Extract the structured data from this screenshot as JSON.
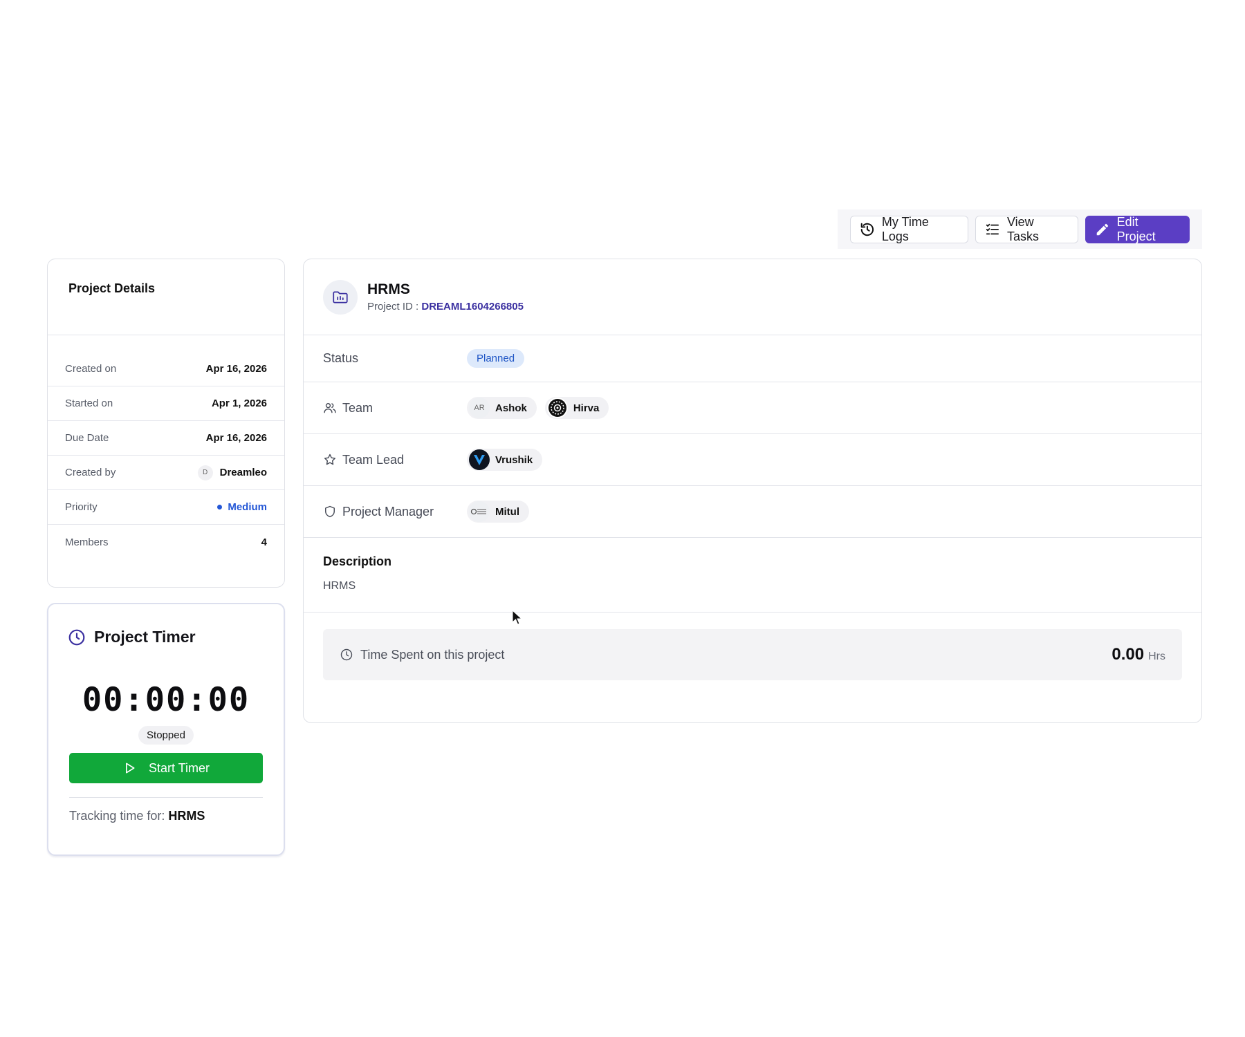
{
  "toolbar": {
    "time_logs_label": "My Time Logs",
    "view_tasks_label": "View Tasks",
    "edit_project_label": "Edit Project"
  },
  "details": {
    "title": "Project Details",
    "rows": [
      {
        "label": "Created on",
        "value": "Apr 16, 2026"
      },
      {
        "label": "Started on",
        "value": "Apr 1, 2026"
      },
      {
        "label": "Due Date",
        "value": "Apr 16, 2026"
      },
      {
        "label": "Created by",
        "value": "Dreamleo",
        "avatar": "D"
      },
      {
        "label": "Priority",
        "value": "Medium"
      },
      {
        "label": "Members",
        "value": "4"
      }
    ]
  },
  "timer": {
    "title": "Project Timer",
    "display": "00:00:00",
    "state": "Stopped",
    "start_label": "Start Timer",
    "tracking_prefix": "Tracking time for:",
    "tracking_project": "HRMS"
  },
  "project": {
    "name": "HRMS",
    "id_label": "Project ID :",
    "id_value": "DREAML1604266805",
    "status_label": "Status",
    "status_value": "Planned",
    "team_label": "Team",
    "team": [
      {
        "initials": "AR",
        "name": "Ashok"
      },
      {
        "initials": "",
        "name": "Hirva"
      }
    ],
    "lead_label": "Team Lead",
    "lead": {
      "name": "Vrushik"
    },
    "manager_label": "Project Manager",
    "manager": {
      "name": "Mitul"
    },
    "description_title": "Description",
    "description": "HRMS",
    "time_spent_label": "Time Spent on this project",
    "time_spent_value": "0.00",
    "time_spent_unit": "Hrs"
  },
  "colors": {
    "primary": "#5b3ec4",
    "success": "#11a83a",
    "priority": "#2457d6",
    "status_bg": "#dde9fb"
  }
}
